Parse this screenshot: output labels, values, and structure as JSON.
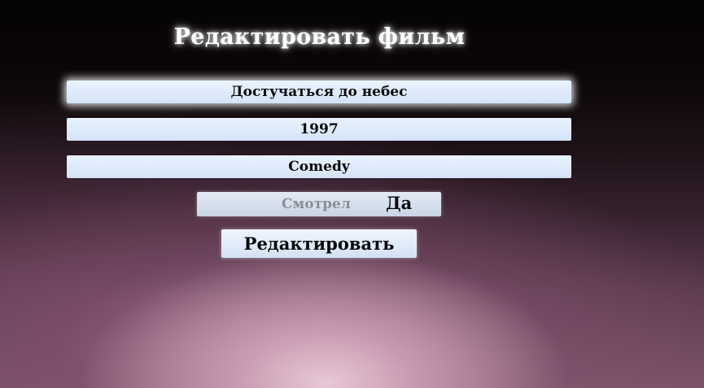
{
  "page": {
    "title": "Редактировать фильм"
  },
  "form": {
    "title_value": "Достучаться до небес",
    "year_value": "1997",
    "genre_value": "Comedy",
    "watched_label": "Смотрел",
    "watched_value": "Да",
    "submit_label": "Редактировать"
  }
}
